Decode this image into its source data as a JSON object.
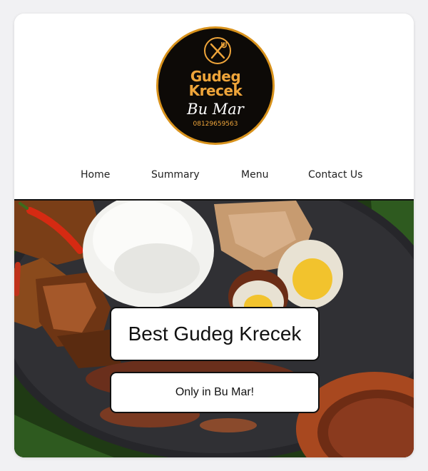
{
  "logo": {
    "line1": "Gudeg",
    "line2": "Krecek",
    "script": "Bu Mar",
    "phone": "08129659563",
    "icon": "fork-knife-icon",
    "colors": {
      "background": "#0d0a07",
      "accent": "#d8921c",
      "text": "#efa53a"
    }
  },
  "nav": {
    "items": [
      {
        "label": "Home"
      },
      {
        "label": "Summary"
      },
      {
        "label": "Menu"
      },
      {
        "label": "Contact Us"
      }
    ]
  },
  "hero": {
    "title": "Best Gudeg Krecek",
    "subtitle": "Only in Bu Mar!",
    "image": "gudeg-plate-photo"
  }
}
